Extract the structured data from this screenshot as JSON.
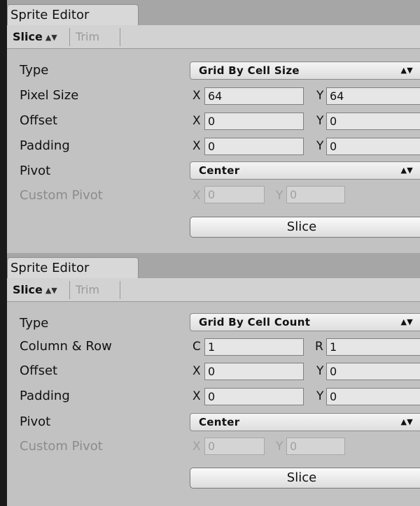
{
  "panels": [
    {
      "tab_title": "Sprite Editor",
      "toolbar": {
        "slice_label": "Slice",
        "trim_label": "Trim"
      },
      "type": {
        "label": "Type",
        "value": "Grid By Cell Size"
      },
      "size_row": {
        "label": "Pixel Size",
        "axis1": "X",
        "value1": "64",
        "axis2": "Y",
        "value2": "64"
      },
      "offset": {
        "label": "Offset",
        "axis1": "X",
        "value1": "0",
        "axis2": "Y",
        "value2": "0"
      },
      "padding": {
        "label": "Padding",
        "axis1": "X",
        "value1": "0",
        "axis2": "Y",
        "value2": "0"
      },
      "pivot": {
        "label": "Pivot",
        "value": "Center"
      },
      "custom_pivot": {
        "label": "Custom Pivot",
        "axis1": "X",
        "value1": "0",
        "axis2": "Y",
        "value2": "0"
      },
      "slice_button": "Slice"
    },
    {
      "tab_title": "Sprite Editor",
      "toolbar": {
        "slice_label": "Slice",
        "trim_label": "Trim"
      },
      "type": {
        "label": "Type",
        "value": "Grid By Cell Count"
      },
      "size_row": {
        "label": "Column & Row",
        "axis1": "C",
        "value1": "1",
        "axis2": "R",
        "value2": "1"
      },
      "offset": {
        "label": "Offset",
        "axis1": "X",
        "value1": "0",
        "axis2": "Y",
        "value2": "0"
      },
      "padding": {
        "label": "Padding",
        "axis1": "X",
        "value1": "0",
        "axis2": "Y",
        "value2": "0"
      },
      "pivot": {
        "label": "Pivot",
        "value": "Center"
      },
      "custom_pivot": {
        "label": "Custom Pivot",
        "axis1": "X",
        "value1": "0",
        "axis2": "Y",
        "value2": "0"
      },
      "slice_button": "Slice"
    }
  ]
}
